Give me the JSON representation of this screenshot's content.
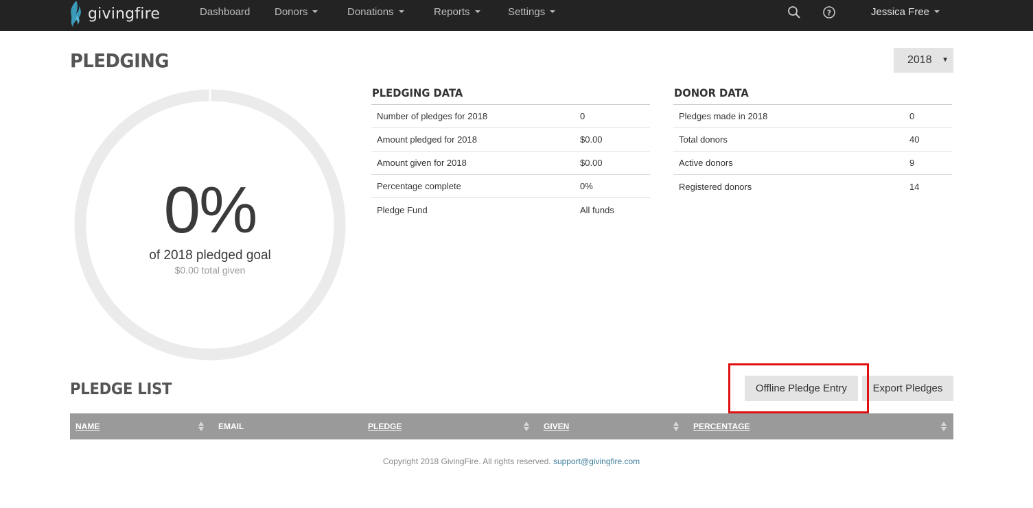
{
  "nav": {
    "brand": "givingfire",
    "items": [
      {
        "label": "Dashboard",
        "dropdown": false
      },
      {
        "label": "Donors",
        "dropdown": true
      },
      {
        "label": "Donations",
        "dropdown": true
      },
      {
        "label": "Reports",
        "dropdown": true
      },
      {
        "label": "Settings",
        "dropdown": true
      }
    ],
    "search_icon": "search-icon",
    "help_icon": "help-circle-icon",
    "user": "Jessica Free"
  },
  "page": {
    "title": "PLEDGING",
    "year_selected": "2018"
  },
  "gauge": {
    "percent_label": "0%",
    "percent_value": 0,
    "subtitle": "of 2018 pledged goal",
    "total_given": "$0.00 total given"
  },
  "pledging_data": {
    "title": "PLEDGING DATA",
    "rows": [
      {
        "label": "Number of pledges for 2018",
        "value": "0"
      },
      {
        "label": "Amount pledged for 2018",
        "value": "$0.00"
      },
      {
        "label": "Amount given for 2018",
        "value": "$0.00"
      },
      {
        "label": "Percentage complete",
        "value": "0%"
      },
      {
        "label": "Pledge Fund",
        "value": "All funds"
      }
    ]
  },
  "donor_data": {
    "title": "DONOR DATA",
    "rows": [
      {
        "label": "Pledges made in 2018",
        "value": "0"
      },
      {
        "label": "Total donors",
        "value": "40"
      },
      {
        "label": "Active donors",
        "value": "9"
      },
      {
        "label": "Registered donors",
        "value": "14"
      }
    ]
  },
  "pledge_list": {
    "title": "PLEDGE LIST",
    "offline_button": "Offline Pledge Entry",
    "export_button": "Export Pledges",
    "columns": [
      {
        "label": "NAME",
        "sortable": true
      },
      {
        "label": "EMAIL",
        "sortable": false
      },
      {
        "label": "PLEDGE",
        "sortable": true
      },
      {
        "label": "GIVEN",
        "sortable": true
      },
      {
        "label": "PERCENTAGE",
        "sortable": true
      }
    ]
  },
  "footer": {
    "text": "Copyright 2018 GivingFire. All rights reserved.",
    "email": "support@givingfire.com"
  },
  "colors": {
    "navbar": "#232323",
    "brand_flame": "#3a9ab8",
    "highlight": "#e01010",
    "table_header": "#9a9a9a"
  }
}
